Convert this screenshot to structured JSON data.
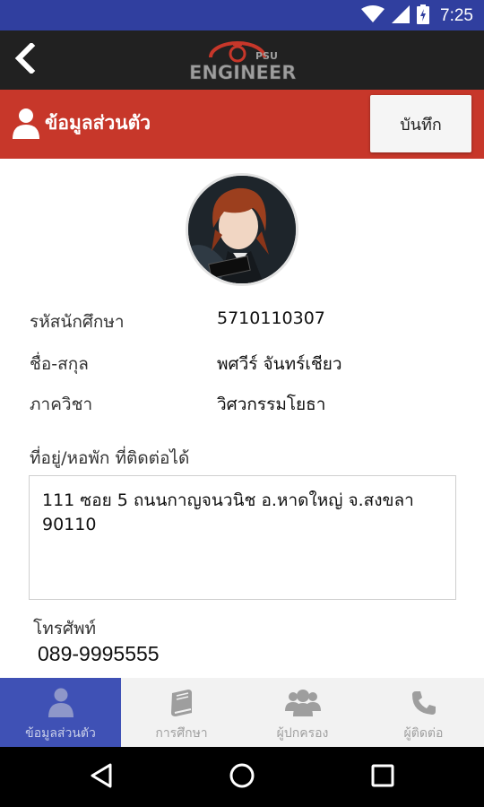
{
  "status_bar": {
    "time": "7:25",
    "icons": [
      "wifi-icon",
      "signal-icon",
      "battery-icon"
    ]
  },
  "app_bar": {
    "logo_text": "ENGINEER",
    "logo_subtext": "PSU",
    "back_icon": "chevron-left-icon"
  },
  "section": {
    "title": "ข้อมูลส่วนตัว",
    "icon": "user-icon",
    "save_label": "บันทึก"
  },
  "profile": {
    "fields": [
      {
        "label": "รหัสนักศึกษา",
        "value": "5710110307"
      },
      {
        "label": "ชื่อ-สกุล",
        "value": "พศวีร์ จันทร์เชียว"
      },
      {
        "label": "ภาควิชา",
        "value": "วิศวกรรมโยธา"
      }
    ],
    "address_label": "ที่อยู่/หอพัก ที่ติดต่อได้",
    "address_value": "111 ซอย 5 ถนนกาญจนวนิช อ.หาดใหญ่ จ.สงขลา 90110",
    "phone_label": "โทรศัพท์",
    "phone_value": "089-9995555"
  },
  "bottom_nav": {
    "items": [
      {
        "label": "ข้อมูลส่วนตัว",
        "icon": "user-icon",
        "active": true
      },
      {
        "label": "การศึกษา",
        "icon": "book-icon",
        "active": false
      },
      {
        "label": "ผู้ปกครอง",
        "icon": "group-icon",
        "active": false
      },
      {
        "label": "ผู้ติดต่อ",
        "icon": "phone-icon",
        "active": false
      }
    ]
  },
  "system_nav": {
    "icons": [
      "back-triangle-icon",
      "home-circle-icon",
      "recents-square-icon"
    ]
  },
  "colors": {
    "status_bar": "#303f9f",
    "app_bar": "#212121",
    "section_bar": "#c7372a",
    "nav_active": "#3f51b5"
  }
}
